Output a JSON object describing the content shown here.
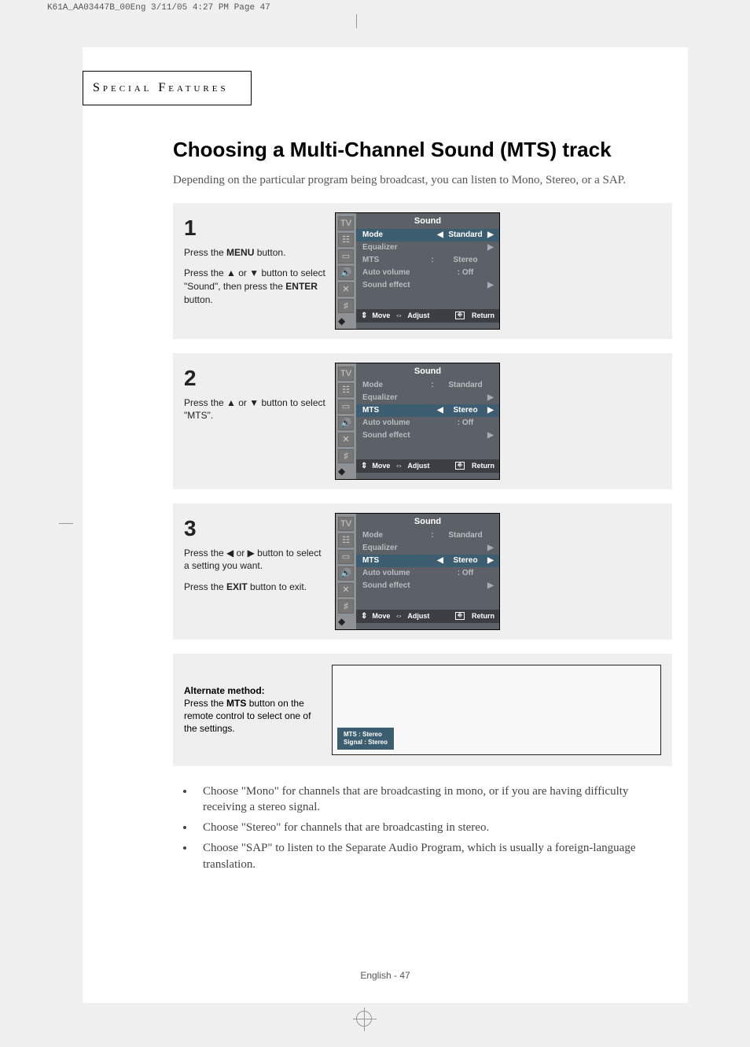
{
  "print_header": "K61A_AA03447B_00Eng  3/11/05  4:27 PM  Page 47",
  "section_label": "Special Features",
  "title": "Choosing a Multi-Channel Sound (MTS) track",
  "intro": "Depending on the particular program being broadcast, you can listen to Mono, Stereo, or a SAP.",
  "steps": [
    {
      "num": "1",
      "lines": [
        {
          "prefix": "Press the ",
          "bold": "MENU",
          "suffix": " button."
        },
        {
          "prefix": "Press the ▲ or ▼ button to select \"Sound\", then press the ",
          "bold": "ENTER",
          "suffix": " button."
        }
      ],
      "osd": {
        "title": "Sound",
        "rows": [
          {
            "label": "Mode",
            "colon": "",
            "val": "Standard",
            "left": "◀",
            "right": "▶",
            "sel": true
          },
          {
            "label": "Equalizer",
            "colon": "",
            "val": "",
            "left": "",
            "right": "▶",
            "sel": false
          },
          {
            "label": "MTS",
            "colon": ":",
            "val": "Stereo",
            "left": "",
            "right": "",
            "sel": false
          },
          {
            "label": "Auto volume",
            "colon": "",
            "val": ": Off",
            "left": "",
            "right": "",
            "sel": false
          },
          {
            "label": "Sound effect",
            "colon": "",
            "val": "",
            "left": "",
            "right": "▶",
            "sel": false
          }
        ]
      }
    },
    {
      "num": "2",
      "lines": [
        {
          "prefix": "Press the ▲ or ▼ button to select \"MTS\".",
          "bold": "",
          "suffix": ""
        }
      ],
      "osd": {
        "title": "Sound",
        "rows": [
          {
            "label": "Mode",
            "colon": ":",
            "val": "Standard",
            "left": "",
            "right": "",
            "sel": false
          },
          {
            "label": "Equalizer",
            "colon": "",
            "val": "",
            "left": "",
            "right": "▶",
            "sel": false
          },
          {
            "label": "MTS",
            "colon": "",
            "val": "Stereo",
            "left": "◀",
            "right": "▶",
            "sel": true
          },
          {
            "label": "Auto volume",
            "colon": "",
            "val": ": Off",
            "left": "",
            "right": "",
            "sel": false
          },
          {
            "label": "Sound effect",
            "colon": "",
            "val": "",
            "left": "",
            "right": "▶",
            "sel": false
          }
        ]
      }
    },
    {
      "num": "3",
      "lines": [
        {
          "prefix": "Press the ◀ or ▶ button to select a setting you want.",
          "bold": "",
          "suffix": ""
        },
        {
          "prefix": "Press the ",
          "bold": "EXIT",
          "suffix": " button to exit."
        }
      ],
      "osd": {
        "title": "Sound",
        "rows": [
          {
            "label": "Mode",
            "colon": ":",
            "val": "Standard",
            "left": "",
            "right": "",
            "sel": false
          },
          {
            "label": "Equalizer",
            "colon": "",
            "val": "",
            "left": "",
            "right": "▶",
            "sel": false
          },
          {
            "label": "MTS",
            "colon": "",
            "val": "Stereo",
            "left": "◀",
            "right": "▶",
            "sel": true
          },
          {
            "label": "Auto volume",
            "colon": "",
            "val": ": Off",
            "left": "",
            "right": "",
            "sel": false
          },
          {
            "label": "Sound effect",
            "colon": "",
            "val": "",
            "left": "",
            "right": "▶",
            "sel": false
          }
        ]
      }
    }
  ],
  "osd_footer": {
    "move": "Move",
    "adjust": "Adjust",
    "ret": "Return",
    "ret_icon": "⬚"
  },
  "icons": [
    "TV",
    "☷",
    "▭",
    "🔊",
    "✕",
    "♯"
  ],
  "alt": {
    "heading": "Alternate method:",
    "body_pre": "Press the ",
    "body_bold": "MTS",
    "body_post": " button on the remote control to select one of the settings.",
    "label_line1": "MTS       : Stereo",
    "label_line2": "Signal    : Stereo"
  },
  "notes": [
    "Choose \"Mono\" for channels that are broadcasting in mono, or if you are having difficulty receiving a stereo signal.",
    "Choose \"Stereo\" for channels that are broadcasting in stereo.",
    "Choose \"SAP\" to listen to the Separate Audio Program, which is usually a foreign-language translation."
  ],
  "footer": "English - 47"
}
